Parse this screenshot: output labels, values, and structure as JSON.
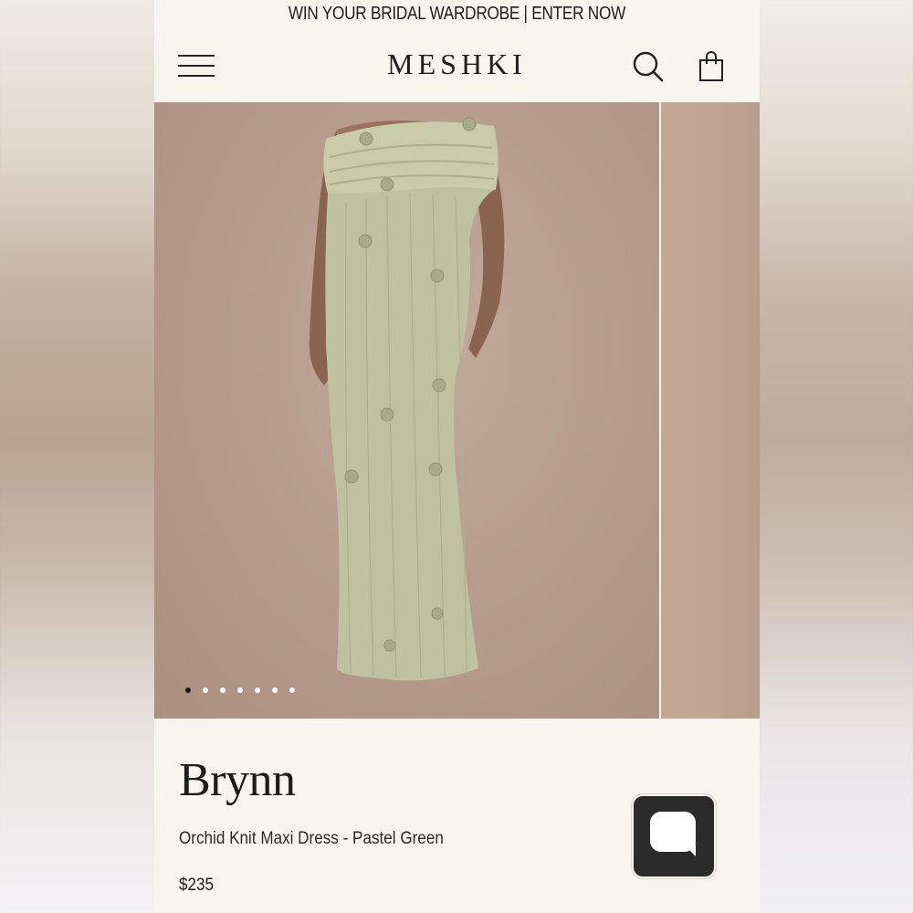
{
  "promo_banner": {
    "text": "WIN YOUR BRIDAL WARDROBE | ENTER NOW"
  },
  "header": {
    "logo": "MESHKI",
    "icons": [
      "menu-icon",
      "search-icon",
      "shopping-bag-icon"
    ]
  },
  "gallery": {
    "slide_count": 7,
    "active_slide": 1
  },
  "product": {
    "name": "Brynn",
    "description": "Orchid Knit Maxi Dress - Pastel Green",
    "price": "$235"
  },
  "chat": {
    "icon": "chat-bubble-icon"
  },
  "colors": {
    "page_background": "#f7f6ee",
    "text": "#1d1d1b",
    "dress": "#bfc2a0",
    "chat_button": "#2b2b2b"
  }
}
